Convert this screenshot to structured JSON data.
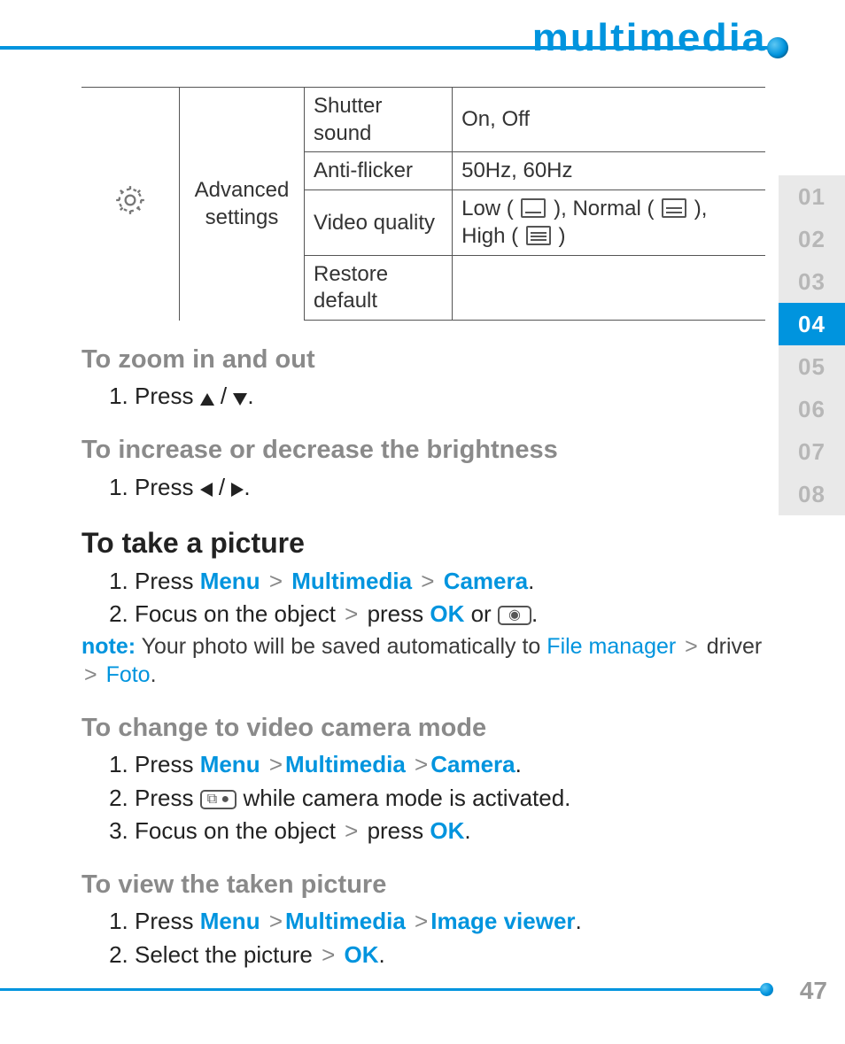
{
  "header": {
    "title": "multimedia"
  },
  "tabs": [
    "01",
    "02",
    "03",
    "04",
    "05",
    "06",
    "07",
    "08"
  ],
  "active_tab_index": 3,
  "page_number": "47",
  "settings_table": {
    "group_label": "Advanced settings",
    "rows": [
      {
        "name": "Shutter sound",
        "value": "On, Off"
      },
      {
        "name": "Anti-flicker",
        "value": "50Hz, 60Hz"
      },
      {
        "name": "Video quality",
        "value_prefix": "Low ( ",
        "value_mid1": " ), Normal ( ",
        "value_mid2": " ), High ( ",
        "value_suffix": " )"
      },
      {
        "name": "Restore default",
        "value": ""
      }
    ]
  },
  "sections": {
    "zoom": {
      "title": "To zoom in and out",
      "step1_pre": "Press ",
      "step1_post": "."
    },
    "brightness": {
      "title": "To increase or decrease the brightness",
      "step1_pre": "Press ",
      "step1_post": "."
    },
    "take": {
      "title": "To take a picture",
      "s1_pre": "Press ",
      "s1_menu": "Menu",
      "s1_mm": "Multimedia",
      "s1_cam": "Camera",
      "s1_post": ".",
      "s2_pre": "Focus on the object ",
      "s2_press": "press ",
      "s2_ok": "OK",
      "s2_or": " or ",
      "s2_post": ".",
      "note_label": "note:",
      "note_text_1": " Your photo will be saved automatically to ",
      "note_fm": "File manager",
      "note_drv": " driver ",
      "note_foto": "Foto",
      "note_post": "."
    },
    "video": {
      "title": "To change to video camera mode",
      "s1_pre": "Press ",
      "s1_menu": "Menu",
      "s1_mm": "Multimedia",
      "s1_cam": "Camera",
      "s1_post": ".",
      "s2_pre": "Press ",
      "s2_post": " while camera mode is activated.",
      "s3_pre": "Focus on the object ",
      "s3_press": "press ",
      "s3_ok": "OK",
      "s3_post": "."
    },
    "view": {
      "title": "To view the taken picture",
      "s1_pre": "Press ",
      "s1_menu": "Menu",
      "s1_mm": "Multimedia",
      "s1_iv": "Image viewer",
      "s1_post": ".",
      "s2_pre": "Select the picture ",
      "s2_ok": "OK",
      "s2_post": "."
    }
  },
  "gt": ">",
  "slash": " / "
}
